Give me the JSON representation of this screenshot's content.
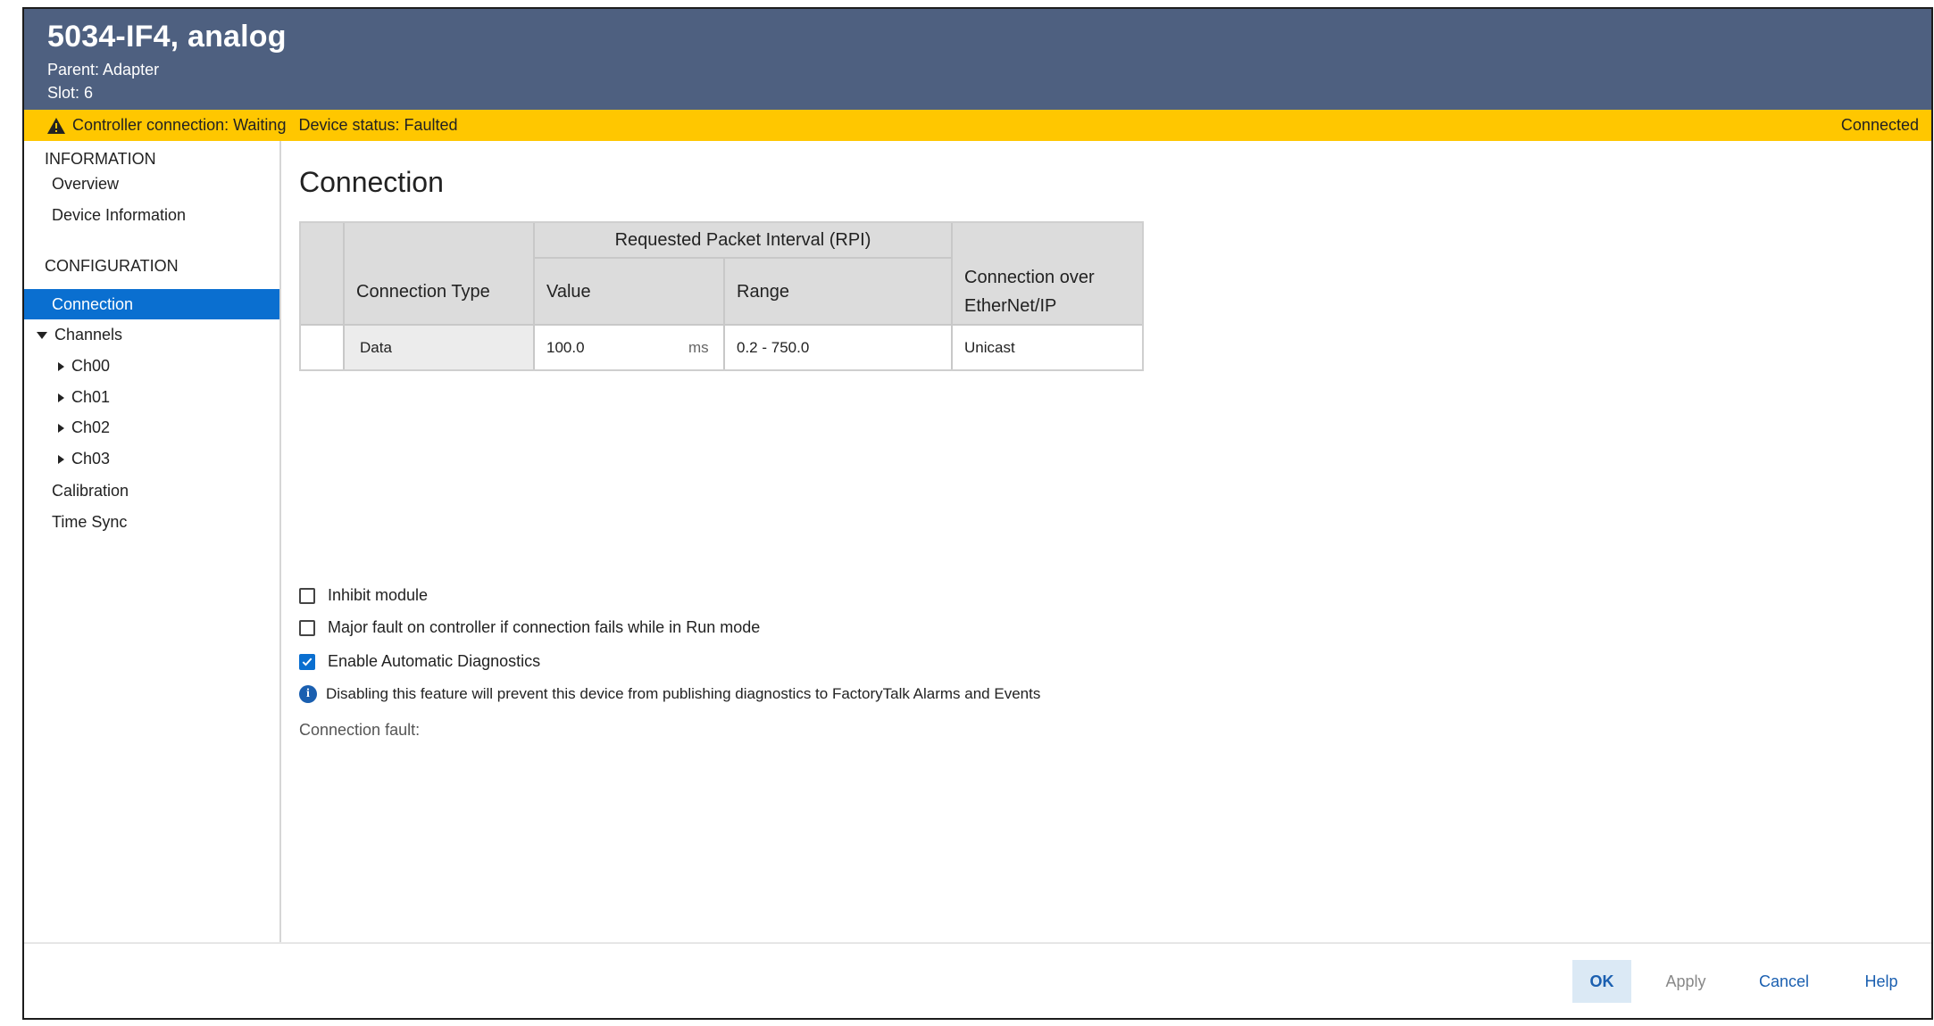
{
  "header": {
    "title": "5034-IF4, analog",
    "parent": "Parent: Adapter",
    "slot": "Slot: 6"
  },
  "status_bar": {
    "controller_connection": "Controller connection: Waiting",
    "device_status": "Device status: Faulted",
    "connection_state": "Connected",
    "background_color": "#ffc700"
  },
  "sidebar": {
    "information_heading": "INFORMATION",
    "information_items": [
      "Overview",
      "Device Information"
    ],
    "configuration_heading": "CONFIGURATION",
    "connection": "Connection",
    "channels": "Channels",
    "channel_items": [
      "Ch00",
      "Ch01",
      "Ch02",
      "Ch03"
    ],
    "calibration": "Calibration",
    "time_sync": "Time Sync",
    "selected_color": "#0a6fd0"
  },
  "main": {
    "page_title": "Connection",
    "table": {
      "group_header": "Requested Packet Interval (RPI)",
      "columns": {
        "connection_type": "Connection Type",
        "value": "Value",
        "range": "Range",
        "connection_over_1": "Connection over",
        "connection_over_2": "EtherNet/IP"
      },
      "row": {
        "connection_type": "Data",
        "value": "100.0",
        "unit": "ms",
        "range": "0.2 - 750.0",
        "connection_over": "Unicast"
      }
    },
    "options": {
      "inhibit_module": {
        "label": "Inhibit module",
        "checked": false
      },
      "major_fault": {
        "label": "Major fault on controller if connection fails while in Run mode",
        "checked": false
      },
      "auto_diagnostics": {
        "label": "Enable Automatic Diagnostics",
        "checked": true
      }
    },
    "info_text": "Disabling this feature will prevent this device from publishing diagnostics to FactoryTalk Alarms and Events",
    "connection_fault_label": "Connection fault:"
  },
  "footer": {
    "ok": "OK",
    "apply": "Apply",
    "cancel": "Cancel",
    "help": "Help"
  },
  "colors": {
    "header_bg": "#4e6080",
    "accent": "#0a6fd0"
  }
}
